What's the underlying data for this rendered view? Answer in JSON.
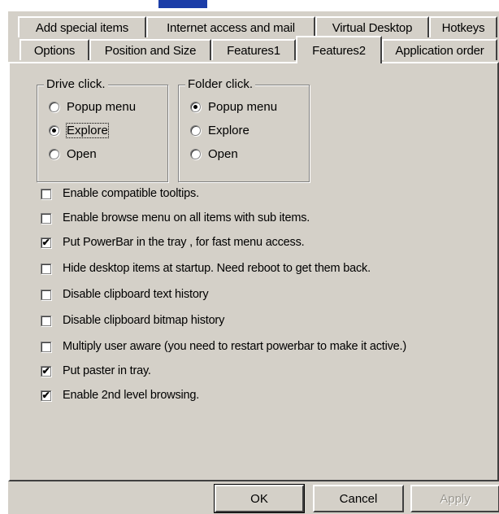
{
  "tabs_back": [
    {
      "label": "Add special items"
    },
    {
      "label": "Internet access and mail"
    },
    {
      "label": "Virtual Desktop"
    },
    {
      "label": "Hotkeys"
    }
  ],
  "tabs_front": [
    {
      "label": "Options"
    },
    {
      "label": "Position and Size"
    },
    {
      "label": "Features1"
    },
    {
      "label": "Features2",
      "active": true
    },
    {
      "label": "Application order"
    }
  ],
  "drive_click": {
    "title": "Drive click.",
    "options": [
      "Popup menu",
      "Explore",
      "Open"
    ],
    "selected": "Explore"
  },
  "folder_click": {
    "title": "Folder click.",
    "options": [
      "Popup menu",
      "Explore",
      "Open"
    ],
    "selected": "Popup menu"
  },
  "checkboxes": [
    {
      "label": "Enable compatible tooltips.",
      "checked": false
    },
    {
      "label": "Enable browse menu on all items with sub items.",
      "checked": false
    },
    {
      "label": "Put PowerBar in the tray , for fast menu access.",
      "checked": true
    },
    {
      "label": "Hide desktop items at startup. Need reboot to get them back.",
      "checked": false
    },
    {
      "label": "Disable clipboard text history",
      "checked": false
    },
    {
      "label": "Disable clipboard bitmap history",
      "checked": false
    },
    {
      "label": "Multiply user aware (you need to restart powerbar to make it active.)",
      "checked": false
    },
    {
      "label": "Put paster in tray.",
      "checked": true
    },
    {
      "label": "Enable 2nd level browsing.",
      "checked": true
    }
  ],
  "buttons": {
    "ok": "OK",
    "cancel": "Cancel",
    "apply": "Apply"
  },
  "check_mark": "✔",
  "colors": {
    "face": "#d4d0c8",
    "highlight": "#ffffff",
    "shadow": "#404040",
    "title_fragment": "#1c3ea8"
  }
}
